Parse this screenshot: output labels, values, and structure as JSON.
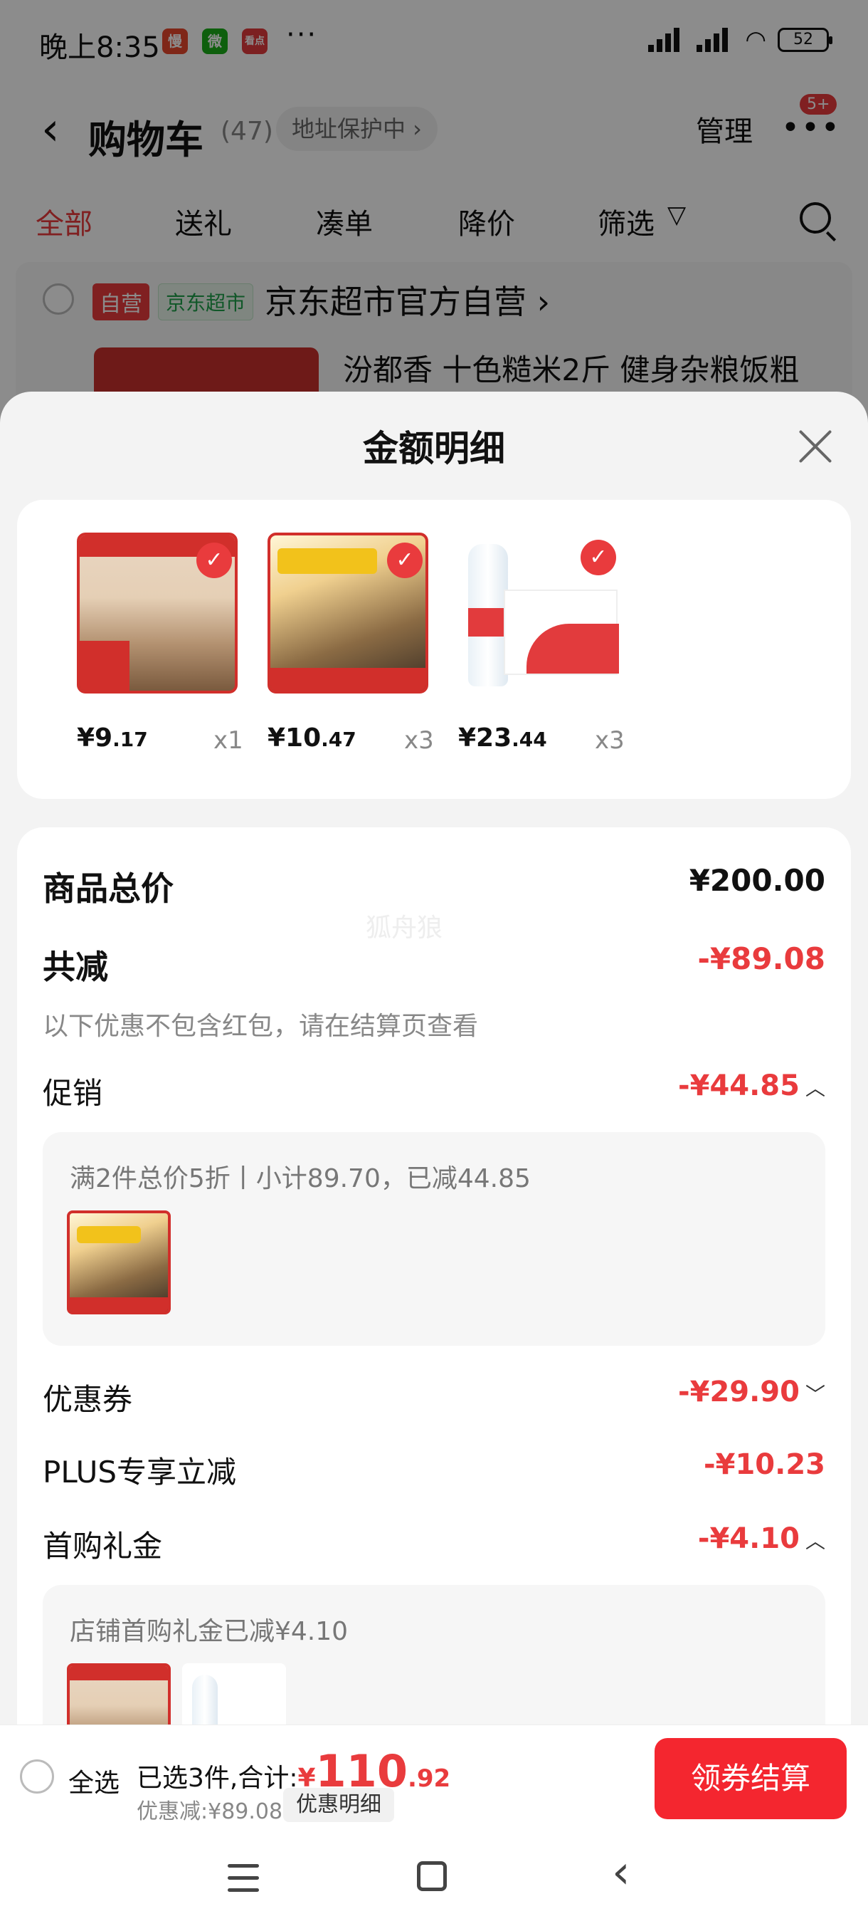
{
  "status_bar": {
    "time": "晚上8:35",
    "apps": [
      "慢",
      "微",
      "看点"
    ],
    "dots": "···",
    "battery": "52"
  },
  "cart_header": {
    "title": "购物车",
    "count": "(47)",
    "address": "地址保护中 ›",
    "manage": "管理",
    "more_badge": "5+"
  },
  "cart_tabs": [
    "全部",
    "送礼",
    "凑单",
    "降价",
    "筛选"
  ],
  "store": {
    "tag_self": "自营",
    "tag_market": "京东超市",
    "name": "京东超市官方自营 ›",
    "product_name": "汾都香 十色糙米2斤 健身杂粮饭粗"
  },
  "sheet": {
    "title": "金额明细",
    "items": [
      {
        "price_int": "¥9",
        "price_dec": ".17",
        "qty": "x1",
        "image": "rice-package-image"
      },
      {
        "price_int": "¥10",
        "price_dec": ".47",
        "qty": "x3",
        "image": "grain-package-image"
      },
      {
        "price_int": "¥23",
        "price_dec": ".44",
        "qty": "x3",
        "image": "water-bottle-image"
      }
    ],
    "rows": {
      "total_label": "商品总价",
      "total_value": "¥200.00",
      "reduce_label": "共减",
      "reduce_value": "-¥89.08",
      "reduce_note": "以下优惠不包含红包，请在结算页查看",
      "promo_label": "促销",
      "promo_value": "-¥44.85",
      "promo_detail": "满2件总价5折丨小计89.70，已减44.85",
      "coupon_label": "优惠券",
      "coupon_value": "-¥29.90",
      "plus_label": "PLUS专享立减",
      "plus_value": "-¥10.23",
      "gift_label": "首购礼金",
      "gift_value": "-¥4.10",
      "gift_detail": "店铺首购礼金已减¥4.10"
    },
    "watermark": "狐舟狼"
  },
  "checkout": {
    "select_all": "全选",
    "summary_prefix": "已选3件,合计:",
    "yen": "¥",
    "amount_int": "110",
    "amount_dec": ".92",
    "discount": "优惠减:¥89.08",
    "detail_button": "优惠明细",
    "checkout_button": "领券结算"
  },
  "colors": {
    "accent": "#e93b3d",
    "button": "#f4262f"
  }
}
